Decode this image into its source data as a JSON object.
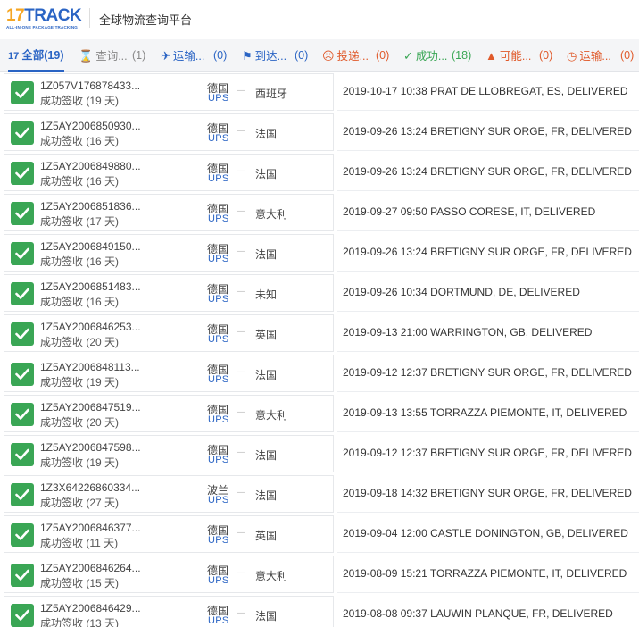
{
  "header": {
    "logo_main_number": "17",
    "logo_main_text": "TRACK",
    "logo_sub": "ALL-IN-ONE PACKAGE TRACKING",
    "site_title": "全球物流查询平台"
  },
  "tabs": [
    {
      "icon": "17",
      "label": "全部",
      "count": "(19)",
      "active": true
    },
    {
      "icon": "⌛",
      "label": "查询...",
      "count": "(1)"
    },
    {
      "icon": "✈",
      "label": "运输...",
      "count": "(0)"
    },
    {
      "icon": "⚑",
      "label": "到达...",
      "count": "(0)"
    },
    {
      "icon": "☹",
      "label": "投递...",
      "count": "(0)"
    },
    {
      "icon": "✓",
      "label": "成功...",
      "count": "(18)"
    },
    {
      "icon": "▲",
      "label": "可能...",
      "count": "(0)"
    },
    {
      "icon": "◷",
      "label": "运输...",
      "count": "(0)"
    }
  ],
  "shipments": [
    {
      "number": "1Z057V176878433...",
      "status": "成功签收 (19 天)",
      "origin": "德国",
      "carrier": "UPS",
      "dest": "西班牙",
      "event": "2019-10-17 10:38 PRAT DE LLOBREGAT, ES, DELIVERED"
    },
    {
      "number": "1Z5AY2006850930...",
      "status": "成功签收 (16 天)",
      "origin": "德国",
      "carrier": "UPS",
      "dest": "法国",
      "event": "2019-09-26 13:24 BRETIGNY SUR ORGE, FR, DELIVERED"
    },
    {
      "number": "1Z5AY2006849880...",
      "status": "成功签收 (16 天)",
      "origin": "德国",
      "carrier": "UPS",
      "dest": "法国",
      "event": "2019-09-26 13:24 BRETIGNY SUR ORGE, FR, DELIVERED"
    },
    {
      "number": "1Z5AY2006851836...",
      "status": "成功签收 (17 天)",
      "origin": "德国",
      "carrier": "UPS",
      "dest": "意大利",
      "event": "2019-09-27 09:50 PASSO CORESE, IT, DELIVERED"
    },
    {
      "number": "1Z5AY2006849150...",
      "status": "成功签收 (16 天)",
      "origin": "德国",
      "carrier": "UPS",
      "dest": "法国",
      "event": "2019-09-26 13:24 BRETIGNY SUR ORGE, FR, DELIVERED"
    },
    {
      "number": "1Z5AY2006851483...",
      "status": "成功签收 (16 天)",
      "origin": "德国",
      "carrier": "UPS",
      "dest": "未知",
      "event": "2019-09-26 10:34 DORTMUND, DE, DELIVERED"
    },
    {
      "number": "1Z5AY2006846253...",
      "status": "成功签收 (20 天)",
      "origin": "德国",
      "carrier": "UPS",
      "dest": "英国",
      "event": "2019-09-13 21:00 WARRINGTON, GB, DELIVERED"
    },
    {
      "number": "1Z5AY2006848113...",
      "status": "成功签收 (19 天)",
      "origin": "德国",
      "carrier": "UPS",
      "dest": "法国",
      "event": "2019-09-12 12:37 BRETIGNY SUR ORGE, FR, DELIVERED"
    },
    {
      "number": "1Z5AY2006847519...",
      "status": "成功签收 (20 天)",
      "origin": "德国",
      "carrier": "UPS",
      "dest": "意大利",
      "event": "2019-09-13 13:55 TORRAZZA PIEMONTE, IT, DELIVERED"
    },
    {
      "number": "1Z5AY2006847598...",
      "status": "成功签收 (19 天)",
      "origin": "德国",
      "carrier": "UPS",
      "dest": "法国",
      "event": "2019-09-12 12:37 BRETIGNY SUR ORGE, FR, DELIVERED"
    },
    {
      "number": "1Z3X64226860334...",
      "status": "成功签收 (27 天)",
      "origin": "波兰",
      "carrier": "UPS",
      "dest": "法国",
      "event": "2019-09-18 14:32 BRETIGNY SUR ORGE, FR, DELIVERED"
    },
    {
      "number": "1Z5AY2006846377...",
      "status": "成功签收 (11 天)",
      "origin": "德国",
      "carrier": "UPS",
      "dest": "英国",
      "event": "2019-09-04 12:00 CASTLE DONINGTON, GB, DELIVERED"
    },
    {
      "number": "1Z5AY2006846264...",
      "status": "成功签收 (15 天)",
      "origin": "德国",
      "carrier": "UPS",
      "dest": "意大利",
      "event": "2019-08-09 15:21 TORRAZZA PIEMONTE, IT, DELIVERED"
    },
    {
      "number": "1Z5AY2006846429...",
      "status": "成功签收 (13 天)",
      "origin": "德国",
      "carrier": "UPS",
      "dest": "法国",
      "event": "2019-08-08 09:37 LAUWIN PLANQUE, FR, DELIVERED"
    }
  ],
  "colors": {
    "brand_blue": "#2a64c4",
    "brand_orange": "#f5a623",
    "success_green": "#3aa655",
    "alert_red": "#e05a2b"
  }
}
